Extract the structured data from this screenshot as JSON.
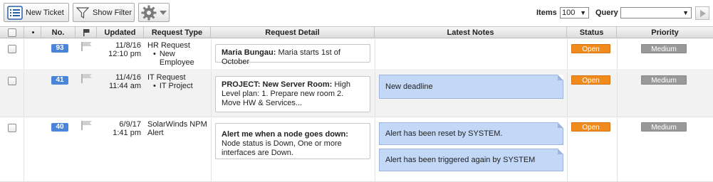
{
  "toolbar": {
    "new_ticket_label": "New Ticket",
    "show_filter_label": "Show Filter",
    "items_label": "Items",
    "items_value": "100",
    "query_label": "Query",
    "query_value": ""
  },
  "columns": {
    "no": "No.",
    "updated": "Updated",
    "request_type": "Request Type",
    "request_detail": "Request Detail",
    "latest_notes": "Latest Notes",
    "status": "Status",
    "priority": "Priority"
  },
  "rows": [
    {
      "number": "93",
      "updated_date": "11/8/16",
      "updated_time": "12:10 pm",
      "type": "HR Request",
      "subtype": "New Employee",
      "detail_title": "Maria Bungau:",
      "detail_text": " Maria starts 1st of October",
      "notes": [],
      "status": "Open",
      "priority": "Medium"
    },
    {
      "number": "41",
      "updated_date": "11/4/16",
      "updated_time": "11:44 am",
      "type": "IT Request",
      "subtype": "IT Project",
      "detail_title": "PROJECT: New Server Room:",
      "detail_text": " High Level plan: 1. Prepare new room 2. Move HW & Services...",
      "notes": [
        "New deadline"
      ],
      "status": "Open",
      "priority": "Medium"
    },
    {
      "number": "40",
      "updated_date": "6/9/17",
      "updated_time": "1:41 pm",
      "type": "SolarWinds NPM Alert",
      "subtype": "",
      "detail_title": "Alert me when a node goes down:",
      "detail_text": " Node status is Down, One or more interfaces are Down.",
      "notes": [
        "Alert has been reset by SYSTEM.",
        "Alert has been triggered again by SYSTEM"
      ],
      "status": "Open",
      "priority": "Medium"
    }
  ],
  "colors": {
    "status_open": "#f08a1d",
    "priority_medium": "#999999",
    "number_badge": "#4a85d9",
    "note_bg": "#c3d7f7"
  }
}
